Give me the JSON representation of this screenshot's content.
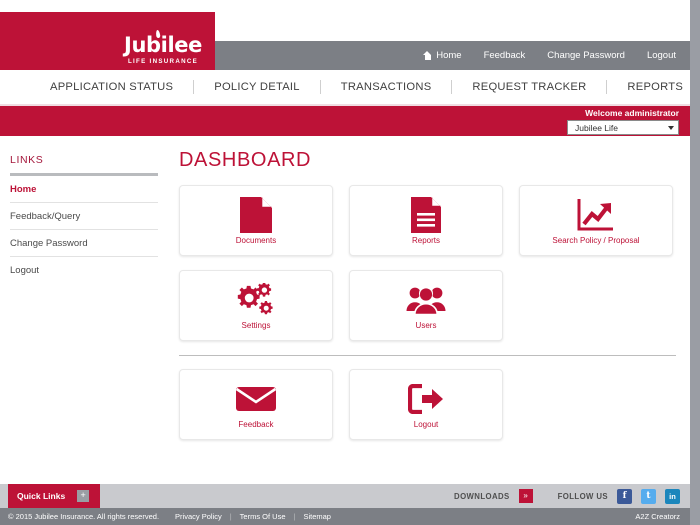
{
  "brand": {
    "logo_text": "Jubilee",
    "logo_tagline": "LIFE INSURANCE",
    "primary_color": "#bd1237",
    "gray_color": "#7c7f85"
  },
  "header": {
    "nav": [
      {
        "label": "Home",
        "icon": "home-icon"
      },
      {
        "label": "Feedback",
        "icon": ""
      },
      {
        "label": "Change Password",
        "icon": ""
      },
      {
        "label": "Logout",
        "icon": ""
      }
    ]
  },
  "tabs": [
    {
      "label": "APPLICATION STATUS"
    },
    {
      "label": "POLICY DETAIL"
    },
    {
      "label": "TRANSACTIONS"
    },
    {
      "label": "REQUEST TRACKER"
    },
    {
      "label": "REPORTS"
    }
  ],
  "welcome": {
    "text": "Welcome administrator",
    "company_selected": "Jubilee Life",
    "company_options": [
      "Jubilee Life"
    ]
  },
  "sidebar": {
    "title": "LINKS",
    "items": [
      {
        "label": "Home",
        "active": true
      },
      {
        "label": "Feedback/Query",
        "active": false
      },
      {
        "label": "Change Password",
        "active": false
      },
      {
        "label": "Logout",
        "active": false
      }
    ]
  },
  "main": {
    "title": "DASHBOARD",
    "cards_row1": [
      {
        "label": "Documents",
        "icon": "document-icon"
      },
      {
        "label": "Reports",
        "icon": "report-lines-icon"
      },
      {
        "label": "Search Policy / Proposal",
        "icon": "chart-arrow-icon"
      }
    ],
    "cards_row2": [
      {
        "label": "Settings",
        "icon": "gears-icon"
      },
      {
        "label": "Users",
        "icon": "users-icon"
      }
    ],
    "cards_row3": [
      {
        "label": "Feedback",
        "icon": "envelope-icon"
      },
      {
        "label": "Logout",
        "icon": "logout-arrow-icon"
      }
    ]
  },
  "footer": {
    "quick_links_label": "Quick Links",
    "quick_links_toggle": "+",
    "downloads_label": "DOWNLOADS",
    "downloads_chevron": "»",
    "follow_label": "FOLLOW US",
    "social": [
      {
        "name": "facebook-icon",
        "glyph": "f"
      },
      {
        "name": "twitter-icon",
        "glyph": "t"
      },
      {
        "name": "linkedin-icon",
        "glyph": "in"
      }
    ],
    "copyright": "© 2015 Jubilee Insurance. All rights reserved.",
    "links": [
      {
        "label": "Privacy Policy"
      },
      {
        "label": "Terms Of Use"
      },
      {
        "label": "Sitemap"
      }
    ],
    "separator": "|",
    "credit": "A2Z Creatorz"
  }
}
